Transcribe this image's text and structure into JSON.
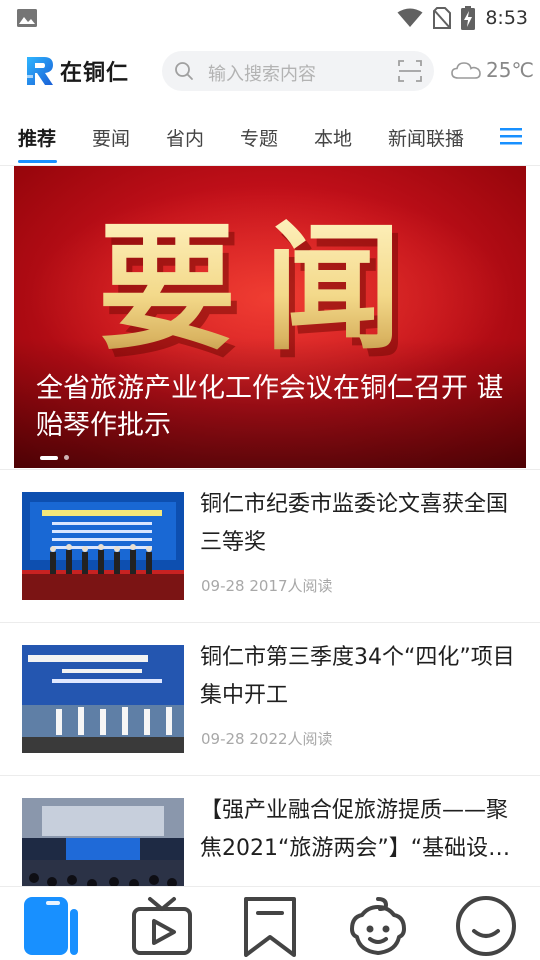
{
  "status_bar": {
    "time": "8:53",
    "icons": [
      "gallery-icon",
      "wifi-icon",
      "no-sim-icon",
      "battery-charging-icon"
    ]
  },
  "header": {
    "logo_text": "在铜仁",
    "search_placeholder": "输入搜索内容",
    "temperature": "25℃",
    "icons": [
      "search-icon",
      "scan-icon",
      "cloud-icon"
    ]
  },
  "tabs": [
    "推荐",
    "要闻",
    "省内",
    "专题",
    "本地",
    "新闻联播"
  ],
  "active_tab": "推荐",
  "banner": {
    "image_text": "要闻",
    "title": "全省旅游产业化工作会议在铜仁召开 谌贻琴作批示",
    "slides": 2,
    "current_slide": 1
  },
  "news": [
    {
      "title": "铜仁市纪委市监委论文喜获全国三等奖",
      "date": "09-28",
      "reads": "2017人阅读"
    },
    {
      "title": "铜仁市第三季度34个“四化”项目集中开工",
      "date": "09-28",
      "reads": "2022人阅读"
    },
    {
      "title": "【强产业融合促旅游提质——聚焦2021“旅游两会”】“基础设…",
      "date": "",
      "reads": ""
    }
  ],
  "bottom_nav": [
    "news-book-icon",
    "tv-play-icon",
    "bookmark-icon",
    "baby-face-icon",
    "smile-icon"
  ],
  "colors": {
    "accent": "#1890ff",
    "banner_red": "#c3101a"
  }
}
